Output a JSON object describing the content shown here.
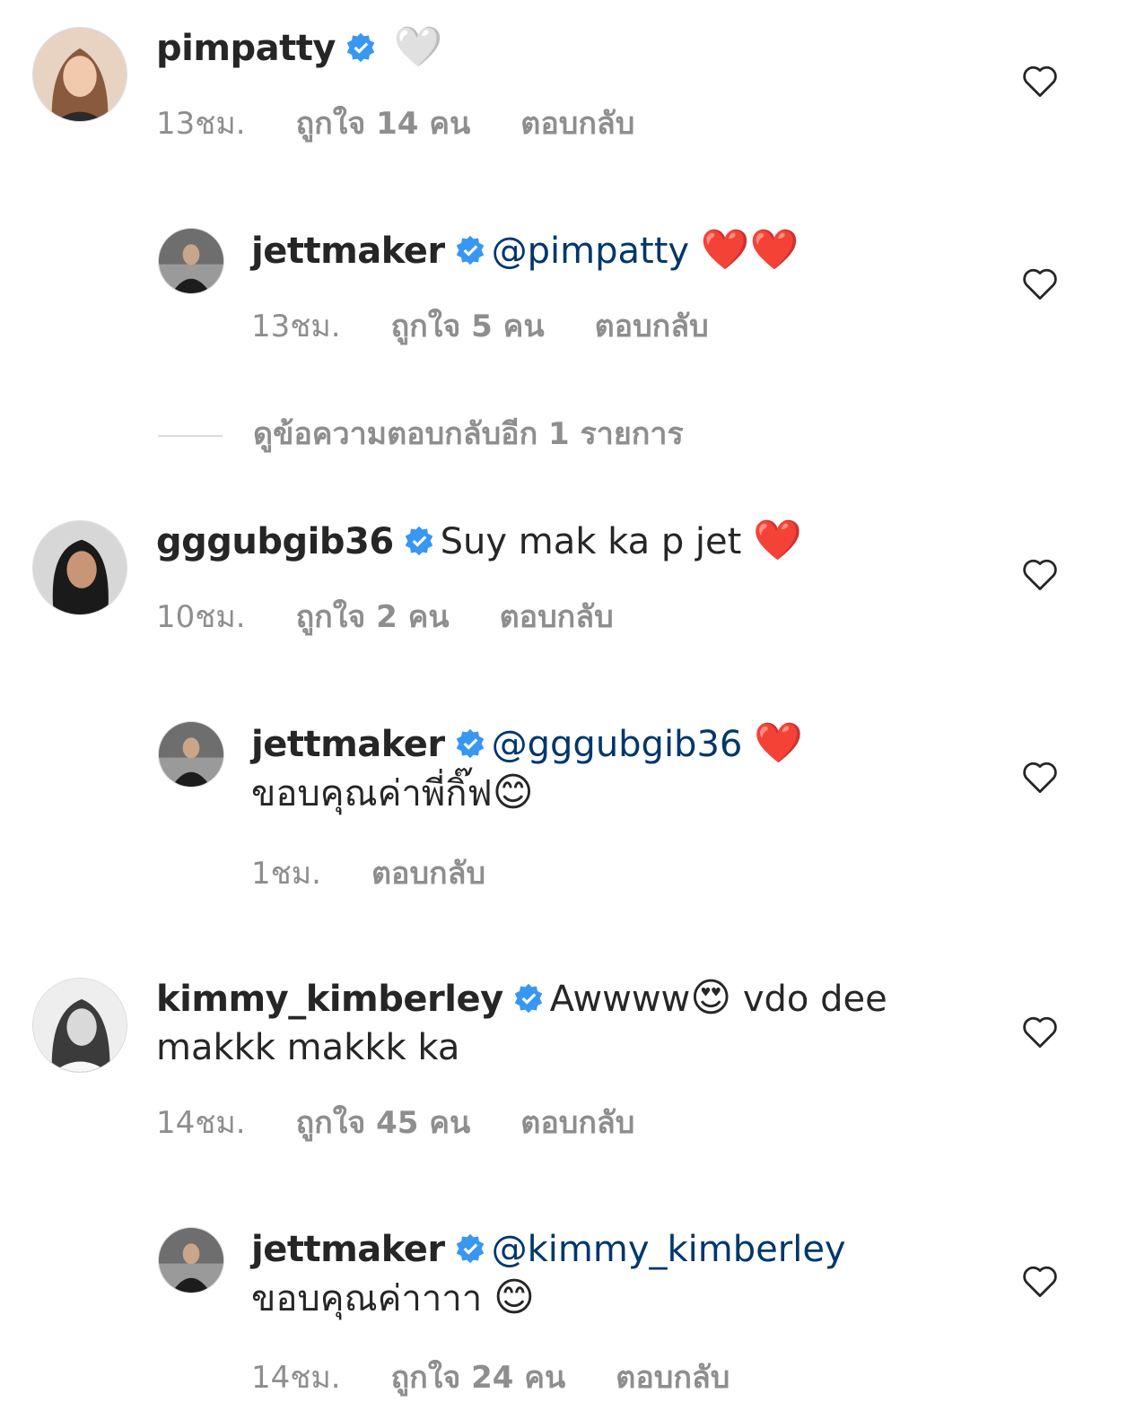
{
  "colors": {
    "text": "#262626",
    "secondary": "#8e8e8e",
    "verified": "#3897f0",
    "mention": "#00376b"
  },
  "comments": [
    {
      "username": "pimpatty",
      "text": "",
      "emoji": "🤍",
      "time": "13ชม.",
      "likes": "ถูกใจ 14 คน",
      "reply": "ตอบกลับ"
    },
    {
      "username": "jettmaker",
      "mention": "@pimpatty",
      "emoji": "❤️❤️",
      "time": "13ชม.",
      "likes": "ถูกใจ 5 คน",
      "reply": "ตอบกลับ"
    },
    {
      "username": "gggubgib36",
      "text": "Suy mak ka p jet",
      "emoji": "❤️",
      "time": "10ชม.",
      "likes": "ถูกใจ 2 คน",
      "reply": "ตอบกลับ"
    },
    {
      "username": "jettmaker",
      "mention": "@gggubgib36",
      "emoji": "❤️",
      "text2": "ขอบคุณค่าพี่กิ๊ฟ",
      "emoji2": "😊",
      "time": "1ชม.",
      "reply": "ตอบกลับ"
    },
    {
      "username": "kimmy_kimberley",
      "text": "Awwww",
      "emoji": "😍",
      "text_after": "vdo dee",
      "text2": "makkk makkk ka",
      "time": "14ชม.",
      "likes": "ถูกใจ 45 คน",
      "reply": "ตอบกลับ"
    },
    {
      "username": "jettmaker",
      "mention": "@kimmy_kimberley",
      "text2": "ขอบคุณค่าาาา",
      "emoji2": "😊",
      "time": "14ชม.",
      "likes": "ถูกใจ 24 คน",
      "reply": "ตอบกลับ"
    }
  ],
  "view_more_replies": "ดูข้อความตอบกลับอีก 1 รายการ"
}
